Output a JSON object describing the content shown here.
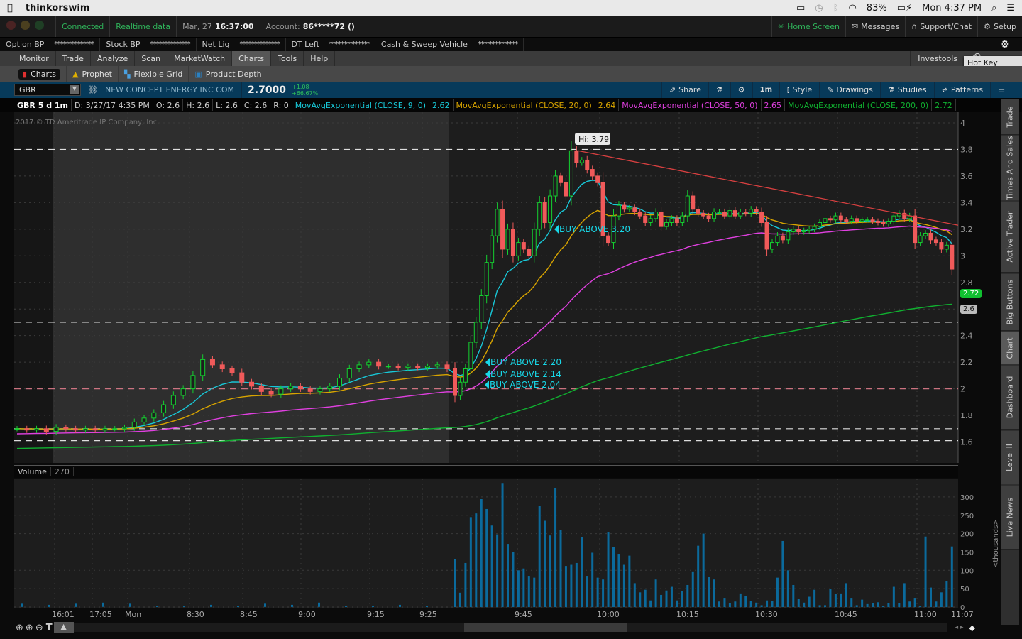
{
  "macbar": {
    "app": "thinkorswim",
    "battery": "83%",
    "clock": "Mon 4:37 PM"
  },
  "status": {
    "connected": "Connected",
    "realtime": "Realtime data",
    "date": "Mar, 27",
    "time": "16:37:00",
    "account_label": "Account:",
    "account": "86*****72 ()"
  },
  "topright": {
    "home": "Home Screen",
    "messages": "Messages",
    "support": "Support/Chat",
    "setup": "Setup"
  },
  "balances": [
    {
      "label": "Option BP",
      "value": "**************"
    },
    {
      "label": "Stock BP",
      "value": "**************"
    },
    {
      "label": "Net Liq",
      "value": "**************"
    },
    {
      "label": "DT Left",
      "value": "**************"
    },
    {
      "label": "Cash & Sweep Vehicle",
      "value": "**************"
    }
  ],
  "menu": {
    "tabs": [
      "Monitor",
      "Trade",
      "Analyze",
      "Scan",
      "MarketWatch",
      "Charts",
      "Tools",
      "Help"
    ],
    "selected": "Charts",
    "investools": "Investools",
    "tooltip": "Hot Key Setup"
  },
  "subtabs": [
    "Charts",
    "Prophet",
    "Flexible Grid",
    "Product Depth"
  ],
  "symbolbar": {
    "symbol": "GBR",
    "description": "NEW CONCEPT ENERGY INC COM",
    "last": "2.7000",
    "change": "+1.08",
    "change_pct": "+66.67%",
    "share": "Share",
    "interval": "1m",
    "style": "Style",
    "drawings": "Drawings",
    "studies": "Studies",
    "patterns": "Patterns"
  },
  "legend": {
    "title": "GBR 5 d 1m",
    "date": "D: 3/27/17 4:35 PM",
    "o": "O: 2.6",
    "h": "H: 2.6",
    "l": "L: 2.6",
    "c": "C: 2.6",
    "r": "R: 0",
    "studies": [
      {
        "name": "MovAvgExponential (CLOSE, 9, 0)",
        "value": "2.62",
        "color": "#18c8d8"
      },
      {
        "name": "MovAvgExponential (CLOSE, 20, 0)",
        "value": "2.64",
        "color": "#d8a400"
      },
      {
        "name": "MovAvgExponential (CLOSE, 50, 0)",
        "value": "2.65",
        "color": "#e040e0"
      },
      {
        "name": "MovAvgExponential (CLOSE, 200, 0)",
        "value": "2.72",
        "color": "#10b030"
      }
    ]
  },
  "copyright": "2017 © TD Ameritrade IP Company, Inc.",
  "chart_data": {
    "type": "candlestick",
    "price_ticks": [
      4,
      3.8,
      3.6,
      3.4,
      3.2,
      3,
      2.8,
      2.6,
      2.4,
      2.2,
      2,
      1.8,
      1.6
    ],
    "price_tick_labels": [
      "4",
      "3.8",
      "3.6",
      "3.4",
      "3.2",
      "3",
      "2.8",
      "2.6",
      "2.4",
      "2.2",
      "2",
      "1.8",
      "1.6"
    ],
    "time_labels": [
      "16:01",
      "17:05",
      "Mon",
      "8:30",
      "8:45",
      "9:00",
      "9:15",
      "9:25",
      "9:45",
      "10:00",
      "10:15",
      "10:30",
      "10:45",
      "11:00",
      "11:07"
    ],
    "premarket_closes": [
      1.7,
      1.69,
      1.7,
      1.68,
      1.71,
      1.7,
      1.69,
      1.7,
      1.69,
      1.7,
      1.7,
      1.71,
      1.75,
      1.78,
      1.82,
      1.88,
      1.95,
      2.0,
      2.1,
      2.22,
      2.18,
      2.15,
      2.12,
      2.05,
      2.02,
      1.98,
      1.96,
      2.0,
      2.02,
      2.0,
      1.98,
      2.0,
      2.02,
      2.08,
      2.15,
      2.18,
      2.2,
      2.17,
      2.17,
      2.16,
      2.17,
      2.16,
      2.17,
      2.18,
      2.15
    ],
    "session_closes": [
      1.95,
      2.05,
      2.15,
      2.35,
      2.5,
      2.7,
      2.95,
      3.15,
      3.35,
      3.05,
      3.2,
      3.0,
      3.1,
      3.05,
      3.0,
      3.2,
      3.4,
      3.25,
      3.45,
      3.6,
      3.55,
      3.45,
      3.79,
      3.7,
      3.72,
      3.65,
      3.6,
      3.55,
      3.15,
      3.1,
      3.3,
      3.38,
      3.35,
      3.36,
      3.33,
      3.3,
      3.25,
      3.28,
      3.33,
      3.22,
      3.25,
      3.28,
      3.25,
      3.3,
      3.45,
      3.35,
      3.32,
      3.3,
      3.28,
      3.33,
      3.33,
      3.3,
      3.34,
      3.3,
      3.33,
      3.32,
      3.35,
      3.33,
      3.25,
      3.05,
      3.1,
      3.15,
      3.12,
      3.18,
      3.2,
      3.18,
      3.19,
      3.2,
      3.22,
      3.25,
      3.28,
      3.27,
      3.3,
      3.27,
      3.26,
      3.28,
      3.26,
      3.27,
      3.27,
      3.26,
      3.25,
      3.24,
      3.26,
      3.3,
      3.32,
      3.28,
      3.3,
      3.1,
      3.15,
      3.17,
      3.12,
      3.1,
      3.05,
      3.08,
      2.9
    ],
    "session_volumes_k": [
      130,
      39,
      120,
      245,
      255,
      294,
      267,
      222,
      198,
      338,
      172,
      150,
      100,
      105,
      85,
      80,
      275,
      235,
      195,
      325,
      210,
      112,
      115,
      120,
      190,
      85,
      148,
      80,
      75,
      203,
      163,
      145,
      115,
      140,
      65,
      40,
      47,
      18,
      75,
      33,
      45,
      55,
      18,
      43,
      60,
      97,
      167,
      200,
      83,
      75,
      15,
      25,
      10,
      15,
      37,
      30,
      17,
      12,
      5,
      18,
      17,
      80,
      180,
      100,
      60,
      22,
      12,
      28,
      47,
      5,
      5,
      50,
      35,
      37,
      65,
      25,
      5,
      20,
      8,
      10,
      13,
      3,
      10,
      55,
      10,
      65,
      15,
      25,
      3,
      192,
      53,
      15,
      40,
      70,
      165
    ],
    "volume_ticks": [
      300,
      250,
      200,
      150,
      100,
      50,
      0
    ],
    "volume_tick_labels": [
      "300",
      "250",
      "200",
      "150",
      "100",
      "50",
      "0"
    ],
    "price_levels": [
      {
        "price": 3.8,
        "color": "#ffffff"
      },
      {
        "price": 2.5,
        "color": "#ffffff"
      },
      {
        "price": 2.0,
        "color": "#e88090"
      },
      {
        "price": 1.7,
        "color": "#ffffff"
      },
      {
        "price": 1.61,
        "color": "#ffffff"
      }
    ],
    "trendline": {
      "from_price": 3.79,
      "to_price": 3.23,
      "color": "#d84040"
    },
    "high_label": "Hi: 3.79",
    "annotations": [
      {
        "text": "BUY ABOVE 3.20",
        "price": 3.2
      },
      {
        "text": "BUY ABOVE 2.20",
        "price": 2.2
      },
      {
        "text": "BUY ABOVE 2.14",
        "price": 2.11
      },
      {
        "text": "BUY ABOVE 2.04",
        "price": 2.03
      }
    ],
    "last_tags": [
      {
        "text": "2.72",
        "price": 2.72,
        "color": "#10c030"
      },
      {
        "text": "2.6",
        "price": 2.6,
        "color": "#bbbbbb"
      }
    ],
    "volume_label": "Volume",
    "volume_value": "270",
    "volume_unit": "<thousands>"
  },
  "sidetabs": [
    "Trade",
    "Times And Sales",
    "Active Trader",
    "Big Buttons",
    "Chart",
    "Dashboard",
    "Level II",
    "Live News"
  ],
  "sidetab_selected": "Chart"
}
